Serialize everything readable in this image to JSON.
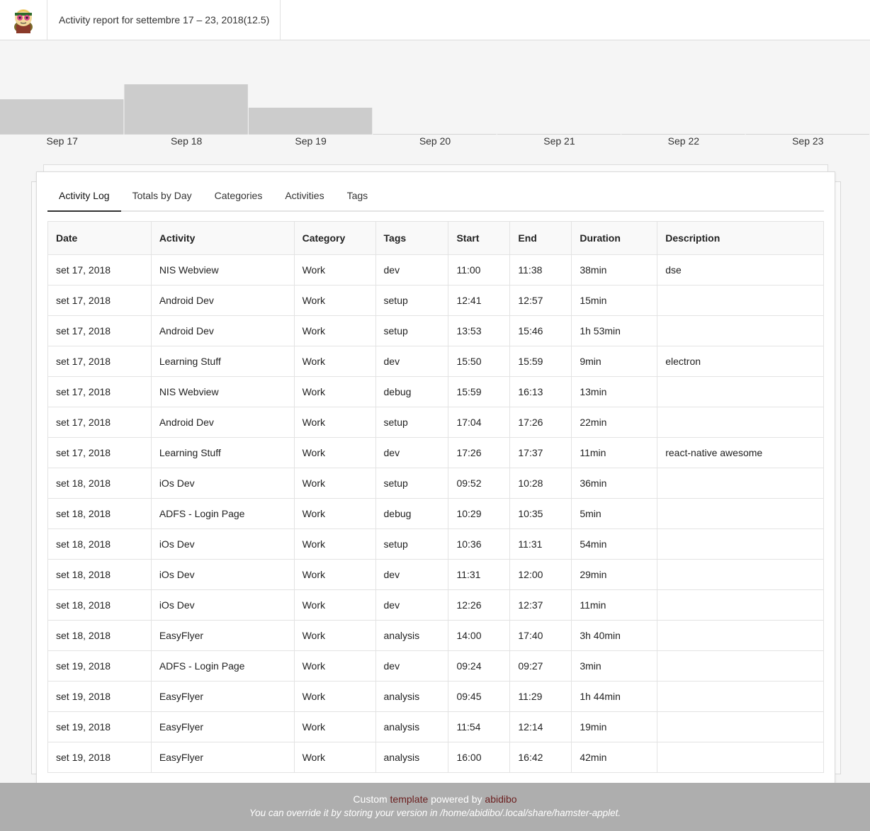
{
  "header": {
    "title": "Activity report for settembre 17 – 23, 2018(12.5)"
  },
  "chart_data": {
    "type": "bar",
    "categories": [
      "Sep 17",
      "Sep 18",
      "Sep 19",
      "Sep 20",
      "Sep 21",
      "Sep 22",
      "Sep 23"
    ],
    "values": [
      3.7,
      5.3,
      2.8,
      0,
      0,
      0,
      0
    ],
    "title": "",
    "xlabel": "",
    "ylabel": "",
    "grid": false
  },
  "tabs": [
    "Activity Log",
    "Totals by Day",
    "Categories",
    "Activities",
    "Tags"
  ],
  "table": {
    "headers": [
      "Date",
      "Activity",
      "Category",
      "Tags",
      "Start",
      "End",
      "Duration",
      "Description"
    ],
    "rows": [
      [
        "set 17, 2018",
        "NIS Webview",
        "Work",
        "dev",
        "11:00",
        "11:38",
        "38min",
        "dse"
      ],
      [
        "set 17, 2018",
        "Android Dev",
        "Work",
        "setup",
        "12:41",
        "12:57",
        "15min",
        ""
      ],
      [
        "set 17, 2018",
        "Android Dev",
        "Work",
        "setup",
        "13:53",
        "15:46",
        "1h 53min",
        ""
      ],
      [
        "set 17, 2018",
        "Learning Stuff",
        "Work",
        "dev",
        "15:50",
        "15:59",
        "9min",
        "electron"
      ],
      [
        "set 17, 2018",
        "NIS Webview",
        "Work",
        "debug",
        "15:59",
        "16:13",
        "13min",
        ""
      ],
      [
        "set 17, 2018",
        "Android Dev",
        "Work",
        "setup",
        "17:04",
        "17:26",
        "22min",
        ""
      ],
      [
        "set 17, 2018",
        "Learning Stuff",
        "Work",
        "dev",
        "17:26",
        "17:37",
        "11min",
        "react-native awesome"
      ],
      [
        "set 18, 2018",
        "iOs Dev",
        "Work",
        "setup",
        "09:52",
        "10:28",
        "36min",
        ""
      ],
      [
        "set 18, 2018",
        "ADFS - Login Page",
        "Work",
        "debug",
        "10:29",
        "10:35",
        "5min",
        ""
      ],
      [
        "set 18, 2018",
        "iOs Dev",
        "Work",
        "setup",
        "10:36",
        "11:31",
        "54min",
        ""
      ],
      [
        "set 18, 2018",
        "iOs Dev",
        "Work",
        "dev",
        "11:31",
        "12:00",
        "29min",
        ""
      ],
      [
        "set 18, 2018",
        "iOs Dev",
        "Work",
        "dev",
        "12:26",
        "12:37",
        "11min",
        ""
      ],
      [
        "set 18, 2018",
        "EasyFlyer",
        "Work",
        "analysis",
        "14:00",
        "17:40",
        "3h 40min",
        ""
      ],
      [
        "set 19, 2018",
        "ADFS - Login Page",
        "Work",
        "dev",
        "09:24",
        "09:27",
        "3min",
        ""
      ],
      [
        "set 19, 2018",
        "EasyFlyer",
        "Work",
        "analysis",
        "09:45",
        "11:29",
        "1h 44min",
        ""
      ],
      [
        "set 19, 2018",
        "EasyFlyer",
        "Work",
        "analysis",
        "11:54",
        "12:14",
        "19min",
        ""
      ],
      [
        "set 19, 2018",
        "EasyFlyer",
        "Work",
        "analysis",
        "16:00",
        "16:42",
        "42min",
        ""
      ]
    ]
  },
  "footer": {
    "custom": "Custom",
    "template_link": "template",
    "powered_by": "powered by",
    "author_link": "abidibo",
    "override_note": "You can override it by storing your version in /home/abidibo/.local/share/hamster-applet."
  },
  "colors": {
    "bar": "#cccccc",
    "footer_bg": "#aeaeae",
    "link": "#6b1e1e"
  }
}
